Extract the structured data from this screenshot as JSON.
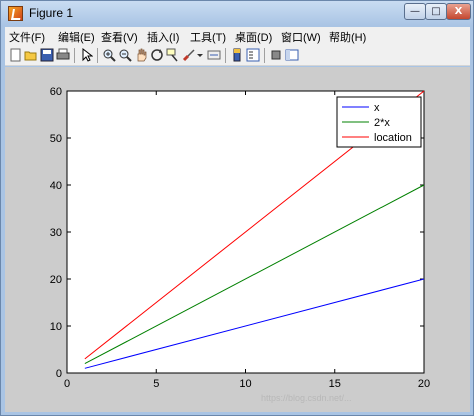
{
  "window": {
    "title": "Figure 1",
    "min_glyph": "—",
    "max_glyph": "□",
    "close_glyph": "X"
  },
  "menu": [
    "文件(F)",
    "编辑(E)",
    "查看(V)",
    "插入(I)",
    "工具(T)",
    "桌面(D)",
    "窗口(W)",
    "帮助(H)"
  ],
  "toolbar_icons": [
    "new-icon",
    "open-icon",
    "save-icon",
    "print-icon",
    "pointer-icon",
    "zoom-in-icon",
    "zoom-out-icon",
    "pan-icon",
    "rotate-icon",
    "data-cursor-icon",
    "brush-icon",
    "link-icon",
    "colorbar-icon",
    "legend-icon",
    "hide-plot-tools-icon",
    "show-plot-tools-icon"
  ],
  "chart_data": {
    "type": "line",
    "xlim": [
      0,
      20
    ],
    "ylim": [
      0,
      60
    ],
    "xticks": [
      0,
      5,
      10,
      15,
      20
    ],
    "yticks": [
      0,
      10,
      20,
      30,
      40,
      50,
      60
    ],
    "grid": false,
    "legend_position": "top-right",
    "series": [
      {
        "name": "x",
        "color": "#0000ff",
        "x": [
          1,
          20
        ],
        "y": [
          1,
          20
        ]
      },
      {
        "name": "2*x",
        "color": "#008000",
        "x": [
          1,
          20
        ],
        "y": [
          2,
          40
        ]
      },
      {
        "name": "location",
        "color": "#ff0000",
        "x": [
          1,
          20
        ],
        "y": [
          3,
          60
        ]
      }
    ]
  },
  "watermark": "https://blog.csdn.net/..."
}
